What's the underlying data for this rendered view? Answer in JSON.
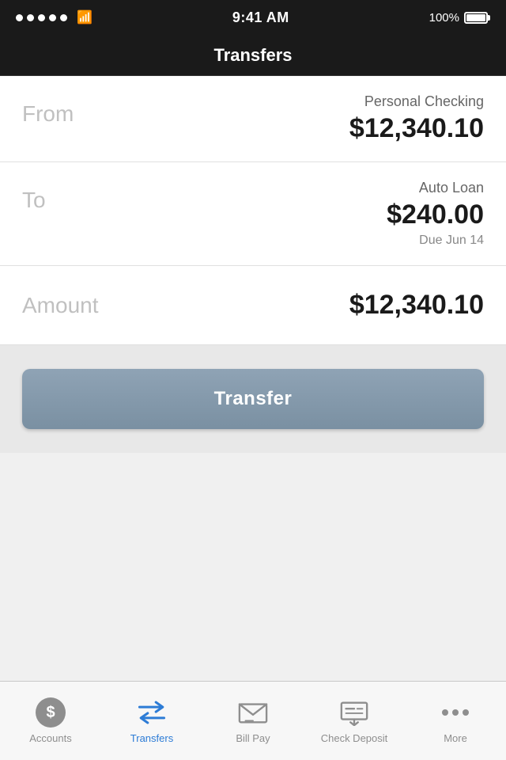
{
  "statusBar": {
    "time": "9:41 AM",
    "battery": "100%",
    "signal": "wifi"
  },
  "navBar": {
    "title": "Transfers"
  },
  "form": {
    "fromLabel": "From",
    "fromAccountName": "Personal Checking",
    "fromAmount": "$12,340.10",
    "toLabel": "To",
    "toAccountName": "Auto Loan",
    "toAmount": "$240.00",
    "toDue": "Due Jun 14",
    "amountLabel": "Amount",
    "amountValue": "$12,340.10"
  },
  "transferButton": {
    "label": "Transfer"
  },
  "tabBar": {
    "items": [
      {
        "id": "accounts",
        "label": "Accounts",
        "active": false
      },
      {
        "id": "transfers",
        "label": "Transfers",
        "active": true
      },
      {
        "id": "billpay",
        "label": "Bill Pay",
        "active": false
      },
      {
        "id": "checkdeposit",
        "label": "Check Deposit",
        "active": false
      },
      {
        "id": "more",
        "label": "More",
        "active": false
      }
    ]
  }
}
